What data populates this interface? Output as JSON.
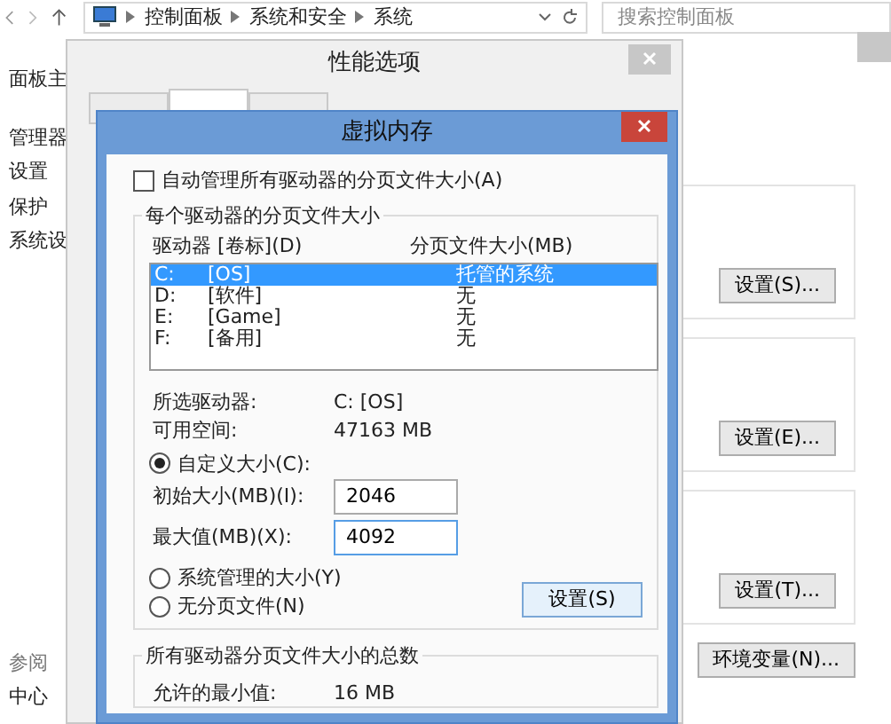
{
  "explorer": {
    "breadcrumbs": [
      "控制面板",
      "系统和安全",
      "系统"
    ],
    "search": {
      "placeholder": "搜索控制面板"
    },
    "sidebar": {
      "items": [
        "面板主",
        "管理器",
        "设置",
        "保护",
        "系统设"
      ]
    },
    "see_also": {
      "items": [
        "参阅",
        "中心"
      ]
    },
    "buttons": [
      "设置(S)...",
      "设置(E)...",
      "设置(T)...",
      "环境变量(N)..."
    ]
  },
  "performance_window": {
    "title": "性能选项",
    "tabs": [
      {
        "selected": false
      },
      {
        "selected": true
      },
      {
        "selected": false
      }
    ]
  },
  "virtual_memory_window": {
    "title": "虚拟内存",
    "auto_manage": {
      "label": "自动管理所有驱动器的分页文件大小(A)",
      "checked": false
    },
    "group_title": "每个驱动器的分页文件大小",
    "columns": [
      "驱动器 [卷标](D)",
      "分页文件大小(MB)"
    ],
    "drives": [
      {
        "letter": "C:",
        "label": "[OS]",
        "size": "托管的系统",
        "selected": true
      },
      {
        "letter": "D:",
        "label": "[软件]",
        "size": "无",
        "selected": false
      },
      {
        "letter": "E:",
        "label": "[Game]",
        "size": "无",
        "selected": false
      },
      {
        "letter": "F:",
        "label": "[备用]",
        "size": "无",
        "selected": false
      }
    ],
    "selected_drive": {
      "label": "所选驱动器:",
      "value": "C:  [OS]"
    },
    "free_space": {
      "label": "可用空间:",
      "value": "47163 MB"
    },
    "size_options": [
      {
        "label": "自定义大小(C):",
        "selected": true
      },
      {
        "label": "系统管理的大小(Y)",
        "selected": false
      },
      {
        "label": "无分页文件(N)",
        "selected": false
      }
    ],
    "initial_size": {
      "label": "初始大小(MB)(I):",
      "value": "2046",
      "focused": false
    },
    "max_size": {
      "label": "最大值(MB)(X):",
      "value": "4092",
      "focused": true
    },
    "set_button": "设置(S)",
    "totals_title": "所有驱动器分页文件大小的总数",
    "totals": [
      {
        "label": "允许的最小值:",
        "value": "16 MB"
      }
    ]
  }
}
